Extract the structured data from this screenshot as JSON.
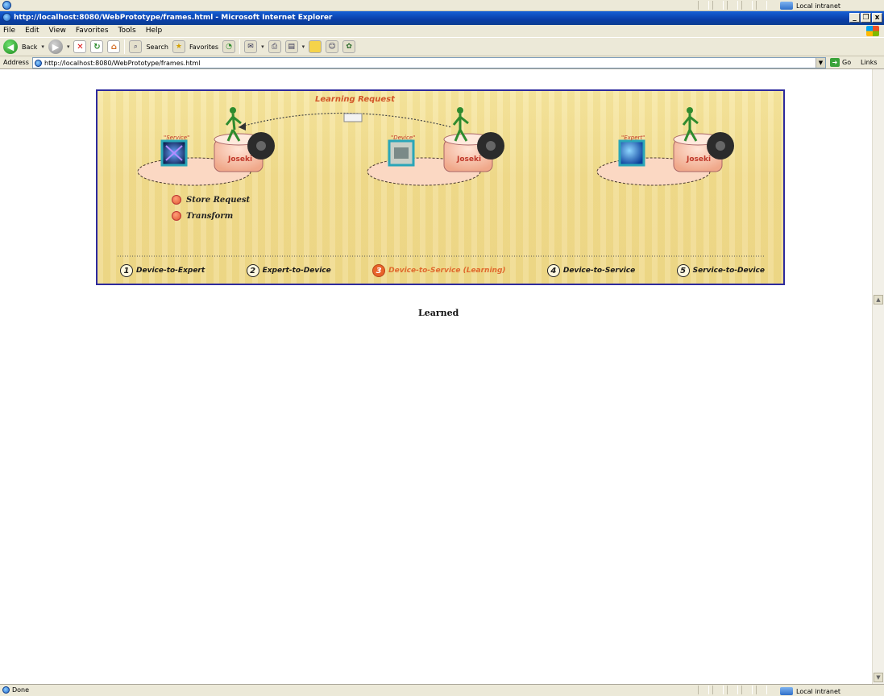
{
  "window": {
    "title": "http://localhost:8080/WebPrototype/frames.html - Microsoft Internet Explorer",
    "controls": {
      "minimize": "_",
      "restore": "❐",
      "close": "x"
    }
  },
  "top_strip": {
    "zone": "Local intranet"
  },
  "menu": {
    "items": [
      "File",
      "Edit",
      "View",
      "Favorites",
      "Tools",
      "Help"
    ]
  },
  "toolbar": {
    "back": "Back",
    "search": "Search",
    "favorites": "Favorites"
  },
  "address": {
    "label": "Address",
    "url": "http://localhost:8080/WebPrototype/frames.html",
    "go": "Go",
    "links": "Links"
  },
  "status": {
    "text": "Done",
    "zone": "Local intranet"
  },
  "banner": {
    "request_label": "Learning Request",
    "nodes": [
      {
        "role": "\"Service\"",
        "server": "Joseki"
      },
      {
        "role": "\"Device\"",
        "server": "Joseki"
      },
      {
        "role": "\"Expert\"",
        "server": "Joseki"
      }
    ],
    "legend": [
      "Store Request",
      "Transform"
    ],
    "steps": [
      {
        "num": "1",
        "label": "Device-to-Expert",
        "active": false
      },
      {
        "num": "2",
        "label": "Expert-to-Device",
        "active": false
      },
      {
        "num": "3",
        "label": "Device-to-Service (Learning)",
        "active": true
      },
      {
        "num": "4",
        "label": "Device-to-Service",
        "active": false
      },
      {
        "num": "5",
        "label": "Service-to-Device",
        "active": false
      }
    ],
    "accent_color": "#e8632a",
    "border_color": "#2d2a9e"
  },
  "content": {
    "result": "Learned"
  }
}
